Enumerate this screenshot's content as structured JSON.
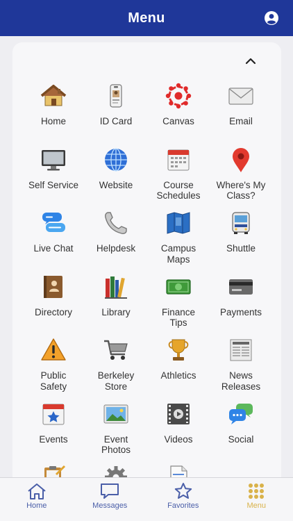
{
  "header": {
    "title": "Menu",
    "account_icon": "account-circle-icon"
  },
  "menu": {
    "collapse_icon": "chevron-up-icon",
    "items": [
      {
        "label": "Home",
        "icon": "house-icon"
      },
      {
        "label": "ID Card",
        "icon": "id-badge-icon"
      },
      {
        "label": "Canvas",
        "icon": "canvas-logo-icon"
      },
      {
        "label": "Email",
        "icon": "envelope-icon"
      },
      {
        "label": "Self Service",
        "icon": "monitor-icon"
      },
      {
        "label": "Website",
        "icon": "globe-icon"
      },
      {
        "label": "Course\nSchedules",
        "icon": "calendar-icon"
      },
      {
        "label": "Where's My\nClass?",
        "icon": "map-pin-icon"
      },
      {
        "label": "Live Chat",
        "icon": "chat-bubbles-icon"
      },
      {
        "label": "Helpdesk",
        "icon": "phone-icon"
      },
      {
        "label": "Campus\nMaps",
        "icon": "folded-map-icon"
      },
      {
        "label": "Shuttle",
        "icon": "bus-icon"
      },
      {
        "label": "Directory",
        "icon": "address-book-icon"
      },
      {
        "label": "Library",
        "icon": "books-icon"
      },
      {
        "label": "Finance\nTips",
        "icon": "money-icon"
      },
      {
        "label": "Payments",
        "icon": "credit-card-icon"
      },
      {
        "label": "Public\nSafety",
        "icon": "warning-icon"
      },
      {
        "label": "Berkeley\nStore",
        "icon": "shopping-cart-icon"
      },
      {
        "label": "Athletics",
        "icon": "trophy-icon"
      },
      {
        "label": "News\nReleases",
        "icon": "newspaper-icon"
      },
      {
        "label": "Events",
        "icon": "event-calendar-icon"
      },
      {
        "label": "Event\nPhotos",
        "icon": "photo-icon"
      },
      {
        "label": "Videos",
        "icon": "film-icon"
      },
      {
        "label": "Social",
        "icon": "social-chat-icon"
      },
      {
        "label": "",
        "icon": "clipboard-icon"
      },
      {
        "label": "",
        "icon": "settings-gear-icon"
      },
      {
        "label": "",
        "icon": "document-icon"
      }
    ]
  },
  "tabbar": {
    "accent_color": "#d9b24a",
    "tabs": [
      {
        "label": "Home",
        "icon": "home-outline-icon",
        "active": false
      },
      {
        "label": "Messages",
        "icon": "message-bubble-icon",
        "active": false
      },
      {
        "label": "Favorites",
        "icon": "star-outline-icon",
        "active": false
      },
      {
        "label": "Menu",
        "icon": "grid-dots-icon",
        "active": true
      }
    ]
  },
  "colors": {
    "header_bg": "#1f3799",
    "tab_inactive": "#4a5ea8",
    "tab_active": "#d9b24a"
  }
}
